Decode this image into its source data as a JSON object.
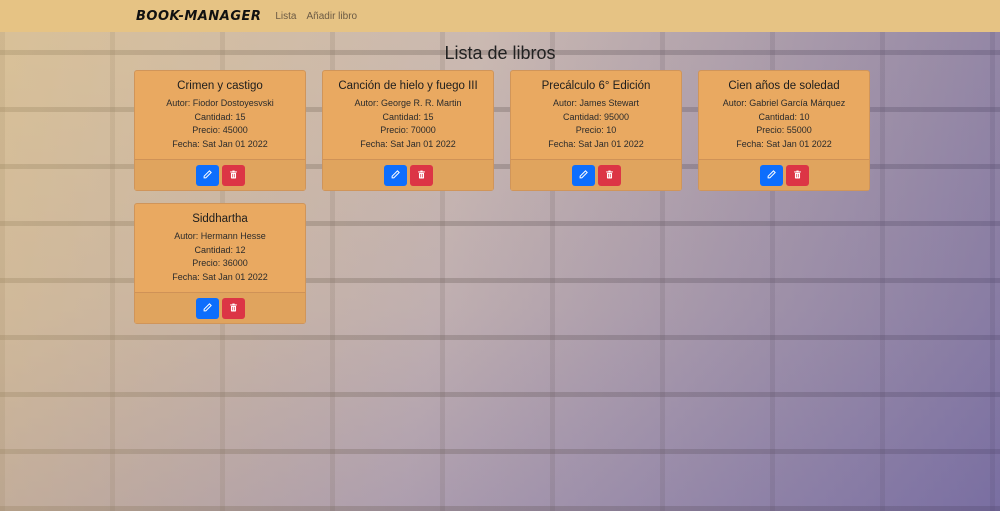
{
  "navbar": {
    "brand": "BOOK-MANAGER",
    "links": [
      "Lista",
      "Añadir libro"
    ]
  },
  "page": {
    "title": "Lista de libros"
  },
  "labels": {
    "author": "Autor:",
    "quantity": "Cantidad:",
    "price": "Precio:",
    "date": "Fecha:"
  },
  "icons": {
    "edit": "pencil-icon",
    "delete": "trash-icon"
  },
  "colors": {
    "navbar": "#e6c384",
    "card": "#e9a961",
    "edit_button": "#0d6efd",
    "delete_button": "#dc3545"
  },
  "books": [
    {
      "title": "Crimen y castigo",
      "author": "Fiodor Dostoyesvski",
      "quantity": "15",
      "price": "45000",
      "date": "Sat Jan 01 2022"
    },
    {
      "title": "Canción de hielo y fuego III",
      "author": "George R. R. Martin",
      "quantity": "15",
      "price": "70000",
      "date": "Sat Jan 01 2022"
    },
    {
      "title": "Precálculo 6° Edición",
      "author": "James Stewart",
      "quantity": "95000",
      "price": "10",
      "date": "Sat Jan 01 2022"
    },
    {
      "title": "Cien años de soledad",
      "author": "Gabriel García Márquez",
      "quantity": "10",
      "price": "55000",
      "date": "Sat Jan 01 2022"
    },
    {
      "title": "Siddhartha",
      "author": "Hermann Hesse",
      "quantity": "12",
      "price": "36000",
      "date": "Sat Jan 01 2022"
    }
  ]
}
